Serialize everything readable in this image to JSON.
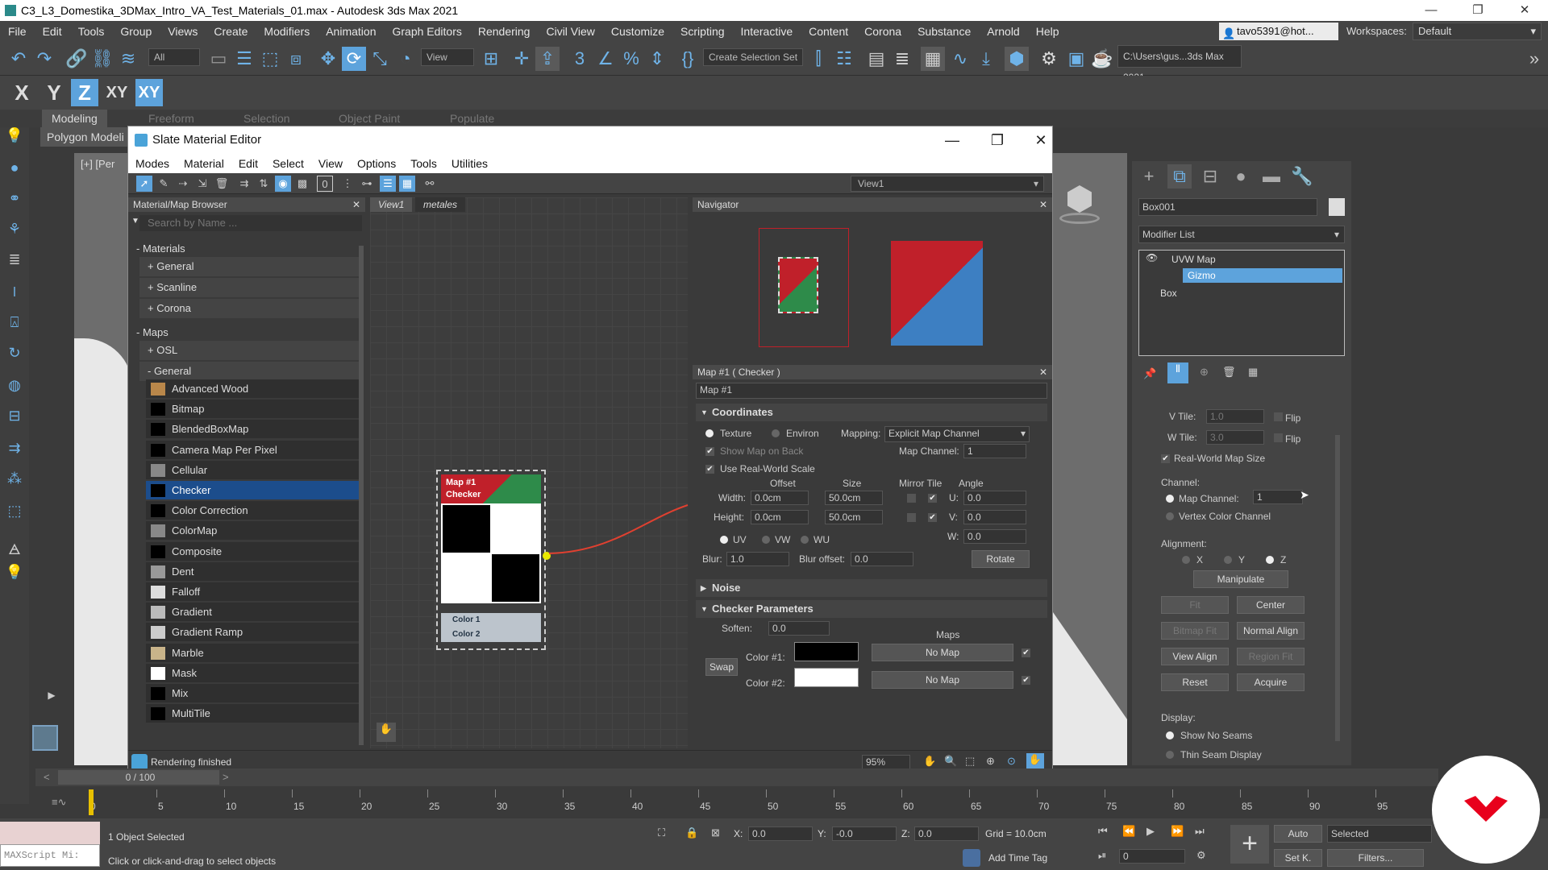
{
  "window": {
    "title": "C3_L3_Domestika_3DMax_Intro_VA_Test_Materials_01.max - Autodesk 3ds Max 2021",
    "controls": [
      "—",
      "❐",
      "✕"
    ]
  },
  "menubar": {
    "items": [
      "File",
      "Edit",
      "Tools",
      "Group",
      "Views",
      "Create",
      "Modifiers",
      "Animation",
      "Graph Editors",
      "Rendering",
      "Civil View",
      "Customize",
      "Scripting",
      "Interactive",
      "Content",
      "Corona",
      "Substance",
      "Arnold",
      "Help"
    ],
    "user": "tavo5391@hot...",
    "workspaces_label": "Workspaces:",
    "workspace": "Default"
  },
  "toolbar": {
    "filter": "All",
    "view": "View",
    "selection_set": "Create Selection Set",
    "path": "C:\\Users\\gus...3ds Max 2021"
  },
  "axes": [
    "X",
    "Y",
    "Z",
    "XY",
    "XY"
  ],
  "ribbon": {
    "tabs": [
      "Modeling",
      "Freeform",
      "Selection",
      "Object Paint",
      "Populate"
    ],
    "active": "Modeling",
    "sub": "Polygon Modeli"
  },
  "viewport": {
    "label": "[+] [Per"
  },
  "slate": {
    "title": "Slate Material Editor",
    "menu": [
      "Modes",
      "Material",
      "Edit",
      "Select",
      "View",
      "Options",
      "Tools",
      "Utilities"
    ],
    "view_select": "View1",
    "browser": {
      "title": "Material/Map Browser",
      "search_placeholder": "Search by Name ...",
      "materials_label": "- Materials",
      "material_groups": [
        "+ General",
        "+ Scanline",
        "+ Corona"
      ],
      "maps_label": "- Maps",
      "osl": "+ OSL",
      "general_open": "- General",
      "maps": [
        {
          "name": "Advanced Wood",
          "swatch": "#b9874a"
        },
        {
          "name": "Bitmap",
          "swatch": "#000000"
        },
        {
          "name": "BlendedBoxMap",
          "swatch": "#000000"
        },
        {
          "name": "Camera Map Per Pixel",
          "swatch": "#000000"
        },
        {
          "name": "Cellular",
          "swatch": "#888888"
        },
        {
          "name": "Checker",
          "swatch": "#000000",
          "selected": true
        },
        {
          "name": "Color Correction",
          "swatch": "#000000"
        },
        {
          "name": "ColorMap",
          "swatch": "#888888"
        },
        {
          "name": "Composite",
          "swatch": "#000000"
        },
        {
          "name": "Dent",
          "swatch": "#999999"
        },
        {
          "name": "Falloff",
          "swatch": "#dddddd"
        },
        {
          "name": "Gradient",
          "swatch": "#bbbbbb"
        },
        {
          "name": "Gradient Ramp",
          "swatch": "#cccccc"
        },
        {
          "name": "Marble",
          "swatch": "#c9b48a"
        },
        {
          "name": "Mask",
          "swatch": "#ffffff"
        },
        {
          "name": "Mix",
          "swatch": "#000000"
        },
        {
          "name": "MultiTile",
          "swatch": "#000000"
        }
      ]
    },
    "tabs": [
      "View1",
      "metales"
    ],
    "node": {
      "title": "Map #1",
      "type": "Checker",
      "slots": [
        "Color 1",
        "Color 2"
      ]
    },
    "navigator_title": "Navigator",
    "params": {
      "header": "Map #1  ( Checker )",
      "name": "Map #1",
      "coords_title": "Coordinates",
      "texture": "Texture",
      "environ": "Environ",
      "mapping_label": "Mapping:",
      "mapping": "Explicit Map Channel",
      "show_map_back": "Show Map on Back",
      "map_channel_label": "Map Channel:",
      "map_channel": "1",
      "real_world": "Use Real-World Scale",
      "col_offset": "Offset",
      "col_size": "Size",
      "col_mirror": "Mirror Tile",
      "col_angle": "Angle",
      "width_label": "Width:",
      "width_offset": "0.0cm",
      "width_size": "50.0cm",
      "height_label": "Height:",
      "height_offset": "0.0cm",
      "height_size": "50.0cm",
      "u_label": "U:",
      "u": "0.0",
      "v_label": "V:",
      "v": "0.0",
      "w_label": "W:",
      "w": "0.0",
      "uv": "UV",
      "vw": "VW",
      "wu": "WU",
      "blur_label": "Blur:",
      "blur": "1.0",
      "blur_offset_label": "Blur offset:",
      "blur_offset": "0.0",
      "rotate": "Rotate",
      "noise_title": "Noise",
      "checker_title": "Checker Parameters",
      "soften_label": "Soften:",
      "soften": "0.0",
      "maps_label": "Maps",
      "swap": "Swap",
      "color1_label": "Color #1:",
      "color2_label": "Color #2:",
      "no_map": "No Map",
      "color1": "#000000",
      "color2": "#ffffff"
    },
    "status": "Rendering finished",
    "zoom": "95%"
  },
  "cmdpanel": {
    "object_name": "Box001",
    "modifier_list": "Modifier List",
    "stack": [
      "UVW Map",
      "Gizmo",
      "Box"
    ],
    "v_tile_label": "V Tile:",
    "v_tile": "1.0",
    "w_tile_label": "W Tile:",
    "w_tile": "3.0",
    "flip": "Flip",
    "real_world": "Real-World Map Size",
    "channel_title": "Channel:",
    "map_channel_label": "Map Channel:",
    "map_channel": "1",
    "vertex_color": "Vertex Color Channel",
    "alignment_title": "Alignment:",
    "ax": "X",
    "ay": "Y",
    "az": "Z",
    "manipulate": "Manipulate",
    "fit": "Fit",
    "center": "Center",
    "bitmap_fit": "Bitmap Fit",
    "normal_align": "Normal Align",
    "view_align": "View Align",
    "region_fit": "Region Fit",
    "reset": "Reset",
    "acquire": "Acquire",
    "display_title": "Display:",
    "show_no_seams": "Show No Seams",
    "thin_seam": "Thin Seam Display"
  },
  "timeline": {
    "frame": "0 / 100",
    "ticks": [
      "0",
      "5",
      "10",
      "15",
      "20",
      "25",
      "30",
      "35",
      "40",
      "45",
      "50",
      "55",
      "60",
      "65",
      "70",
      "75",
      "80",
      "85",
      "90",
      "95"
    ]
  },
  "statusbar": {
    "maxscript": "MAXScript Mi:",
    "selected": "1 Object Selected",
    "hint": "Click or click-and-drag to select objects",
    "x_label": "X:",
    "x": "0.0",
    "y_label": "Y:",
    "y": "-0.0",
    "z_label": "Z:",
    "z": "0.0",
    "grid": "Grid = 10.0cm",
    "add_time_tag": "Add Time Tag",
    "auto": "Auto",
    "setk": "Set K.",
    "selected_dd": "Selected",
    "filters": "Filters...",
    "frame_field": "0"
  }
}
